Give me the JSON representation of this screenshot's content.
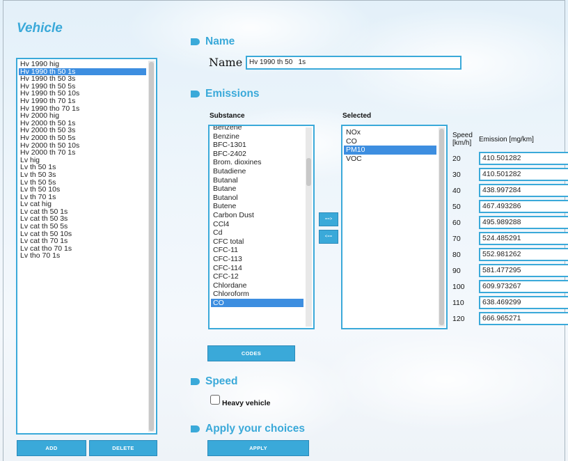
{
  "vehicle": {
    "title": "Vehicle",
    "items": [
      "Hv 1990 hig",
      "Hv 1990 th 50 1s",
      "Hv 1990 th 50 3s",
      "Hv 1990 th 50 5s",
      "Hv 1990 th 50 10s",
      "Hv 1990 th 70 1s",
      "Hv 1990 tho 70 1s",
      "Hv 2000 hig",
      "Hv 2000 th 50 1s",
      "Hv 2000 th 50 3s",
      "Hv 2000 th 50 5s",
      "Hv 2000 th 50 10s",
      "Hv 2000 th 70 1s",
      "Lv hig",
      "Lv th 50 1s",
      "Lv th 50 3s",
      "Lv th 50 5s",
      "Lv th 50 10s",
      "Lv th 70 1s",
      "Lv cat hig",
      "Lv cat th 50 1s",
      "Lv cat th 50 3s",
      "Lv cat th 50 5s",
      "Lv cat th 50 10s",
      "Lv cat th 70 1s",
      "Lv cat tho 70 1s",
      "Lv tho 70 1s"
    ],
    "selected_index": 1,
    "add_label": "ADD",
    "delete_label": "DELETE"
  },
  "name_section": {
    "heading": "Name",
    "label": "Name",
    "value": "Hv 1990 th 50   1s"
  },
  "emissions": {
    "heading": "Emissions",
    "substance_label": "Substance",
    "selected_label": "Selected",
    "substances": [
      "Benzene",
      "Benzine",
      "BFC-1301",
      "BFC-2402",
      "Brom. dioxines",
      "Butadiene",
      "Butanal",
      "Butane",
      "Butanol",
      "Butene",
      "Carbon Dust",
      "CCl4",
      "Cd",
      "CFC total",
      "CFC-11",
      "CFC-113",
      "CFC-114",
      "CFC-12",
      "Chlordane",
      "Chloroform",
      "CO"
    ],
    "substance_selected_index": 20,
    "selected": [
      "NOx",
      "CO",
      "PM10",
      "VOC"
    ],
    "selected_selected_index": 2,
    "add_arrow": "==>",
    "remove_arrow": "<==",
    "codes_label": "CODES",
    "speed_header": "Speed\n[km/h]",
    "emission_header": "Emission [mg/km]",
    "rows": [
      {
        "speed": "20",
        "emission": "410.501282"
      },
      {
        "speed": "30",
        "emission": "410.501282"
      },
      {
        "speed": "40",
        "emission": "438.997284"
      },
      {
        "speed": "50",
        "emission": "467.493286"
      },
      {
        "speed": "60",
        "emission": "495.989288"
      },
      {
        "speed": "70",
        "emission": "524.485291"
      },
      {
        "speed": "80",
        "emission": "552.981262"
      },
      {
        "speed": "90",
        "emission": "581.477295"
      },
      {
        "speed": "100",
        "emission": "609.973267"
      },
      {
        "speed": "110",
        "emission": "638.469299"
      },
      {
        "speed": "120",
        "emission": "666.965271"
      }
    ]
  },
  "speed_section": {
    "heading": "Speed",
    "heavy_vehicle_label": "Heavy vehicle",
    "heavy_vehicle_checked": false
  },
  "apply_section": {
    "heading": "Apply your choices",
    "apply_label": "APPLY"
  },
  "colors": {
    "accent": "#3aa9d9",
    "selection": "#3d8ee0"
  }
}
